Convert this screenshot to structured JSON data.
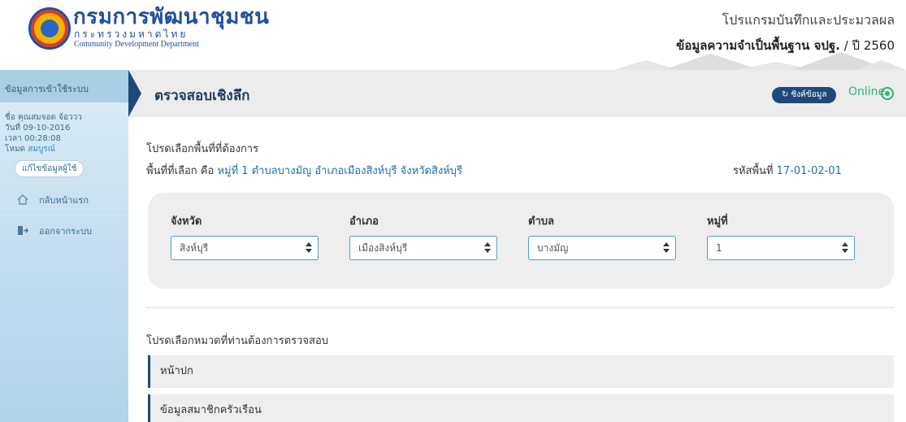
{
  "header": {
    "org_name_th": "กรมการพัฒนาชุมชน",
    "ministry_th": "กระทรวงมหาดไทย",
    "org_name_en": "Community Development Department",
    "program_title": "โปรแกรมบันทึกและประมวลผล",
    "program_subtitle": "ข้อมูลความจำเป็นพื้นฐาน จปฐ.",
    "year_text": "/ ปี 2560"
  },
  "sidebar": {
    "header": "ข้อมูลการเข้าใช้ระบบ",
    "user_name": "ชื่อ คุณสมจอด จ้อววว",
    "date": "วันที่ 09-10-2016",
    "time": "เวลา 00:28:08",
    "mode_label": "โหมด",
    "mode_value": "สมบูรณ์",
    "edit_button": "แก้ไขข้อมูลผู้ใช้",
    "items": [
      {
        "label": "กลับหน้าแรก",
        "icon": "home-icon"
      },
      {
        "label": "ออกจากระบบ",
        "icon": "logout-icon"
      }
    ]
  },
  "titlebar": {
    "title": "ตรวจสอบเชิงลึก",
    "sync_button": "ซิงค์ข้อมูล",
    "status": "Online"
  },
  "main": {
    "prompt_area": "โปรดเลือกพื้นที่ที่ต้องการ",
    "selected_prefix": "พื้นที่ที่เลือก คือ",
    "selected_value": "หมู่ที่ 1 ตำบลบางมัญ อำเภอเมืองสิงห์บุรี จังหวัดสิงห์บุรี",
    "area_code_label": "รหัสพื้นที่",
    "area_code_value": "17-01-02-01",
    "filters": [
      {
        "label": "จังหวัด",
        "value": "สิงห์บุรี"
      },
      {
        "label": "อำเภอ",
        "value": "เมืองสิงห์บุรี"
      },
      {
        "label": "ตำบล",
        "value": "บางมัญ"
      },
      {
        "label": "หมู่ที่",
        "value": "1"
      }
    ],
    "prompt_category": "โปรดเลือกหมวดที่ท่านต้องการตรวจสอบ",
    "categories": [
      "หน้าปก",
      "ข้อมูลสมาชิกครัวเรือน"
    ]
  },
  "colors": {
    "navy": "#1e4a7b",
    "link_blue": "#1f6fa8",
    "online_green": "#31b27a",
    "select_border": "#4c9fcf"
  }
}
